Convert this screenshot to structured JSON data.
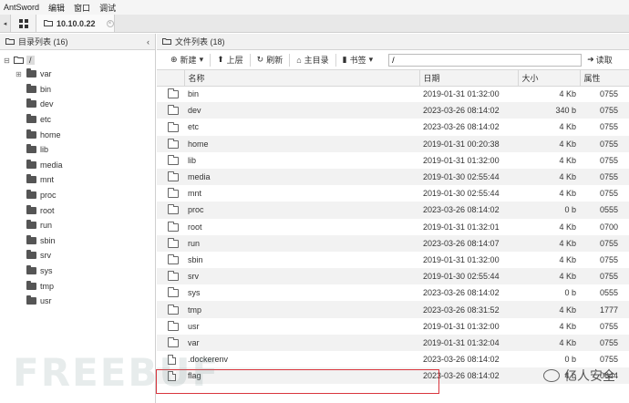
{
  "menubar": {
    "items": [
      "AntSword",
      "编辑",
      "窗口",
      "调试"
    ]
  },
  "tabs": {
    "arrow": "◂",
    "active_label": "10.10.0.22",
    "close": "×"
  },
  "left_panel": {
    "title": "目录列表 (16)",
    "root": "/",
    "items": [
      {
        "name": "var",
        "expandable": true
      },
      {
        "name": "bin"
      },
      {
        "name": "dev"
      },
      {
        "name": "etc"
      },
      {
        "name": "home"
      },
      {
        "name": "lib"
      },
      {
        "name": "media"
      },
      {
        "name": "mnt"
      },
      {
        "name": "proc"
      },
      {
        "name": "root"
      },
      {
        "name": "run"
      },
      {
        "name": "sbin"
      },
      {
        "name": "srv"
      },
      {
        "name": "sys"
      },
      {
        "name": "tmp"
      },
      {
        "name": "usr"
      }
    ]
  },
  "right_panel": {
    "title": "文件列表 (18)",
    "toolbar": {
      "new": "新建",
      "up": "上层",
      "refresh": "刷新",
      "home": "主目录",
      "bookmarks": "书签",
      "path_value": "/",
      "read": "读取"
    },
    "columns": {
      "name": "名称",
      "date": "日期",
      "size": "大小",
      "perm": "属性"
    },
    "rows": [
      {
        "type": "dir",
        "name": "bin",
        "date": "2019-01-31 01:32:00",
        "size": "4 Kb",
        "perm": "0755"
      },
      {
        "type": "dir",
        "name": "dev",
        "date": "2023-03-26 08:14:02",
        "size": "340 b",
        "perm": "0755"
      },
      {
        "type": "dir",
        "name": "etc",
        "date": "2023-03-26 08:14:02",
        "size": "4 Kb",
        "perm": "0755"
      },
      {
        "type": "dir",
        "name": "home",
        "date": "2019-01-31 00:20:38",
        "size": "4 Kb",
        "perm": "0755"
      },
      {
        "type": "dir",
        "name": "lib",
        "date": "2019-01-31 01:32:00",
        "size": "4 Kb",
        "perm": "0755"
      },
      {
        "type": "dir",
        "name": "media",
        "date": "2019-01-30 02:55:44",
        "size": "4 Kb",
        "perm": "0755"
      },
      {
        "type": "dir",
        "name": "mnt",
        "date": "2019-01-30 02:55:44",
        "size": "4 Kb",
        "perm": "0755"
      },
      {
        "type": "dir",
        "name": "proc",
        "date": "2023-03-26 08:14:02",
        "size": "0 b",
        "perm": "0555"
      },
      {
        "type": "dir",
        "name": "root",
        "date": "2019-01-31 01:32:01",
        "size": "4 Kb",
        "perm": "0700"
      },
      {
        "type": "dir",
        "name": "run",
        "date": "2023-03-26 08:14:07",
        "size": "4 Kb",
        "perm": "0755"
      },
      {
        "type": "dir",
        "name": "sbin",
        "date": "2019-01-31 01:32:00",
        "size": "4 Kb",
        "perm": "0755"
      },
      {
        "type": "dir",
        "name": "srv",
        "date": "2019-01-30 02:55:44",
        "size": "4 Kb",
        "perm": "0755"
      },
      {
        "type": "dir",
        "name": "sys",
        "date": "2023-03-26 08:14:02",
        "size": "0 b",
        "perm": "0555"
      },
      {
        "type": "dir",
        "name": "tmp",
        "date": "2023-03-26 08:31:52",
        "size": "4 Kb",
        "perm": "1777"
      },
      {
        "type": "dir",
        "name": "usr",
        "date": "2019-01-31 01:32:00",
        "size": "4 Kb",
        "perm": "0755"
      },
      {
        "type": "dir",
        "name": "var",
        "date": "2019-01-31 01:32:04",
        "size": "4 Kb",
        "perm": "0755"
      },
      {
        "type": "file",
        "name": ".dockerenv",
        "date": "2023-03-26 08:14:02",
        "size": "0 b",
        "perm": "0755"
      },
      {
        "type": "file",
        "name": "flag",
        "date": "2023-03-26 08:14:02",
        "size": "4 b",
        "perm": "0644"
      }
    ]
  },
  "watermark": {
    "left": "FREEBUF",
    "right": "亿人安全"
  },
  "colors": {
    "highlight": "#d9363e"
  }
}
